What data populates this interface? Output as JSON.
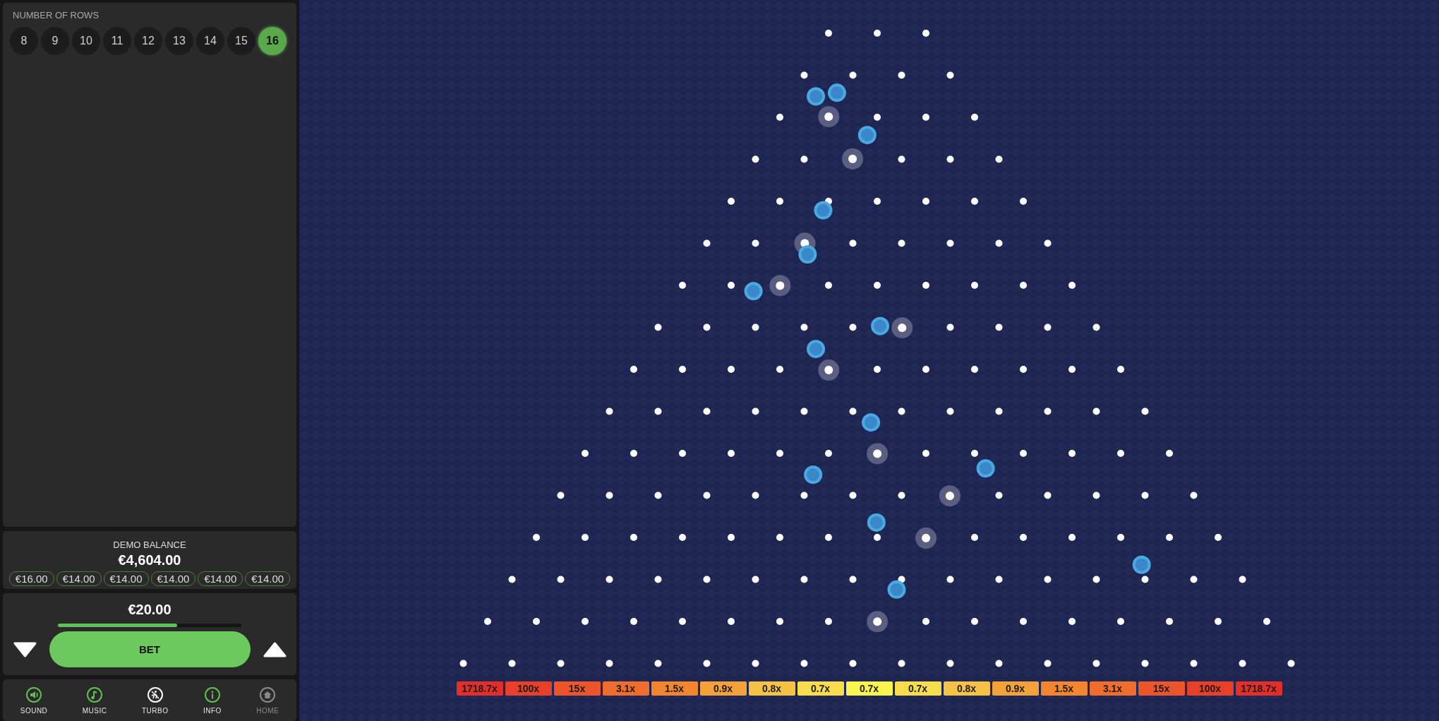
{
  "rows_selector": {
    "label": "NUMBER OF ROWS",
    "options": [
      {
        "label": "8",
        "selected": false
      },
      {
        "label": "9",
        "selected": false
      },
      {
        "label": "10",
        "selected": false
      },
      {
        "label": "11",
        "selected": false
      },
      {
        "label": "12",
        "selected": false
      },
      {
        "label": "13",
        "selected": false
      },
      {
        "label": "14",
        "selected": false
      },
      {
        "label": "15",
        "selected": false
      },
      {
        "label": "16",
        "selected": true
      }
    ]
  },
  "balance": {
    "label": "DEMO BALANCE",
    "amount": "€4,604.00",
    "history": [
      "€16.00",
      "€14.00",
      "€14.00",
      "€14.00",
      "€14.00",
      "€14.00"
    ]
  },
  "bet": {
    "amount": "€20.00",
    "level": 0.65,
    "button": "BET"
  },
  "toolbar": [
    {
      "kind": "sound",
      "label": "SOUND",
      "on": true,
      "disabled": false
    },
    {
      "kind": "music",
      "label": "MUSIC",
      "on": true,
      "disabled": false
    },
    {
      "kind": "turbo",
      "label": "TURBO",
      "on": false,
      "disabled": false
    },
    {
      "kind": "info",
      "label": "INFO",
      "on": true,
      "disabled": false
    },
    {
      "kind": "home",
      "label": "HOME",
      "on": false,
      "disabled": true
    }
  ],
  "multipliers": [
    {
      "label": "1718.7x",
      "color": "#e22f2a"
    },
    {
      "label": "100x",
      "color": "#e83f28"
    },
    {
      "label": "15x",
      "color": "#ec5429"
    },
    {
      "label": "3.1x",
      "color": "#ef6e2d"
    },
    {
      "label": "1.5x",
      "color": "#f2862f"
    },
    {
      "label": "0.9x",
      "color": "#f3a23a"
    },
    {
      "label": "0.8x",
      "color": "#f5c245"
    },
    {
      "label": "0.7x",
      "color": "#f7dc4c"
    },
    {
      "label": "0.7x",
      "color": "#f8f64e"
    },
    {
      "label": "0.7x",
      "color": "#f7dc4c"
    },
    {
      "label": "0.8x",
      "color": "#f5c245"
    },
    {
      "label": "0.9x",
      "color": "#f3a23a"
    },
    {
      "label": "1.5x",
      "color": "#f2862f"
    },
    {
      "label": "3.1x",
      "color": "#ef6e2d"
    },
    {
      "label": "15x",
      "color": "#ec5429"
    },
    {
      "label": "100x",
      "color": "#e83f28"
    },
    {
      "label": "1718.7x",
      "color": "#e22f2a"
    }
  ]
}
